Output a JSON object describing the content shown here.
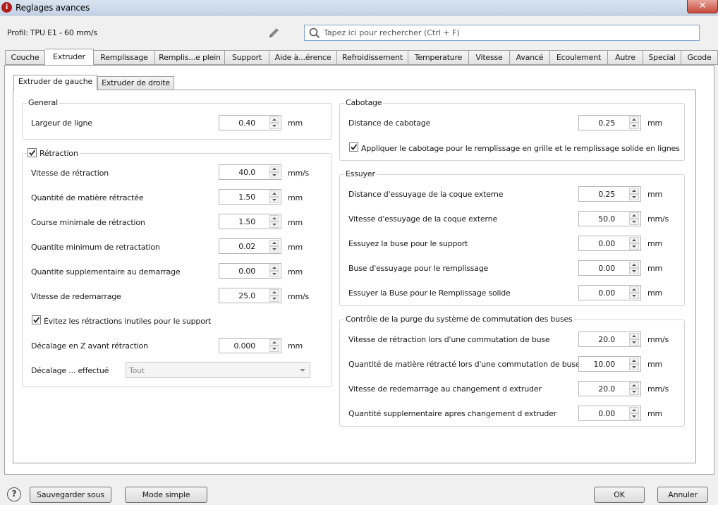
{
  "window": {
    "title": "Reglages avances",
    "close_symbol": "✕"
  },
  "profile": {
    "label": "Profil: TPU E1 - 60 mm/s"
  },
  "search": {
    "placeholder": "Tapez ici pour rechercher (Ctrl + F)",
    "value": ""
  },
  "main_tabs": [
    "Couche",
    "Extruder",
    "Remplissage",
    "Remplis...e plein",
    "Support",
    "Aide à...érence",
    "Refroidissement",
    "Temperature",
    "Vitesse",
    "Avancé",
    "Ecoulement",
    "Autre",
    "Special",
    "Gcode"
  ],
  "active_main_tab": "Extruder",
  "sub_tabs": [
    "Extruder de gauche",
    "Extruder de droite"
  ],
  "active_sub_tab": "Extruder de gauche",
  "left": {
    "general": {
      "title": "General",
      "rows": [
        {
          "label": "Largeur de ligne",
          "value": "0.40",
          "unit": "mm"
        }
      ]
    },
    "retraction": {
      "title": "Rétraction",
      "checked": true,
      "rows": [
        {
          "label": "Vitesse de rétraction",
          "value": "40.0",
          "unit": "mm/s"
        },
        {
          "label": "Quantité de matière rétractée",
          "value": "1.50",
          "unit": "mm"
        },
        {
          "label": "Course minimale de rétraction",
          "value": "1.50",
          "unit": "mm"
        },
        {
          "label": "Quantite minimum de retractation",
          "value": "0.02",
          "unit": "mm"
        },
        {
          "label": "Quantite supplementaire au demarrage",
          "value": "0.00",
          "unit": "mm"
        },
        {
          "label": "Vitesse de redemarrage",
          "value": "25.0",
          "unit": "mm/s"
        }
      ],
      "avoid_checkbox": {
        "label": "Évitez les rétractions inutiles pour le support",
        "checked": true
      },
      "z_offset": {
        "label": "Décalage en Z avant rétraction",
        "value": "0.000",
        "unit": "mm"
      },
      "offset_done": {
        "label": "Décalage ... effectué",
        "value": "Tout"
      }
    }
  },
  "right": {
    "coasting": {
      "title": "Cabotage",
      "rows": [
        {
          "label": "Distance de cabotage",
          "value": "0.25",
          "unit": "mm"
        }
      ],
      "checkbox": {
        "label": "Appliquer le cabotage pour le remplissage en grille et le remplissage solide en lignes",
        "checked": true
      }
    },
    "wipe": {
      "title": "Essuyer",
      "rows": [
        {
          "label": "Distance d'essuyage de la coque externe",
          "value": "0.25",
          "unit": "mm"
        },
        {
          "label": "Vitesse d'essuyage de la coque externe",
          "value": "50.0",
          "unit": "mm/s"
        },
        {
          "label": "Essuyez la buse pour le support",
          "value": "0.00",
          "unit": "mm"
        },
        {
          "label": "Buse d'essuyage pour le remplissage",
          "value": "0.00",
          "unit": "mm"
        },
        {
          "label": "Essuyer la Buse pour le Remplissage solide",
          "value": "0.00",
          "unit": "mm"
        }
      ]
    },
    "purge": {
      "title": "Contrôle de la purge du système de commutation des buses",
      "rows": [
        {
          "label": "Vitesse de rétraction lors d'une commutation de buse",
          "value": "20.0",
          "unit": "mm/s"
        },
        {
          "label": "Quantité de matière rétracté lors d'une commutation de buse",
          "value": "10.00",
          "unit": "mm"
        },
        {
          "label": "Vitesse de redemarrage au changement d extruder",
          "value": "20.0",
          "unit": "mm/s"
        },
        {
          "label": "Quantité supplementaire apres changement d extruder",
          "value": "0.00",
          "unit": "mm"
        }
      ]
    }
  },
  "footer": {
    "help_symbol": "?",
    "save_as": "Sauvegarder sous",
    "simple_mode": "Mode simple",
    "ok": "OK",
    "cancel": "Annuler"
  }
}
